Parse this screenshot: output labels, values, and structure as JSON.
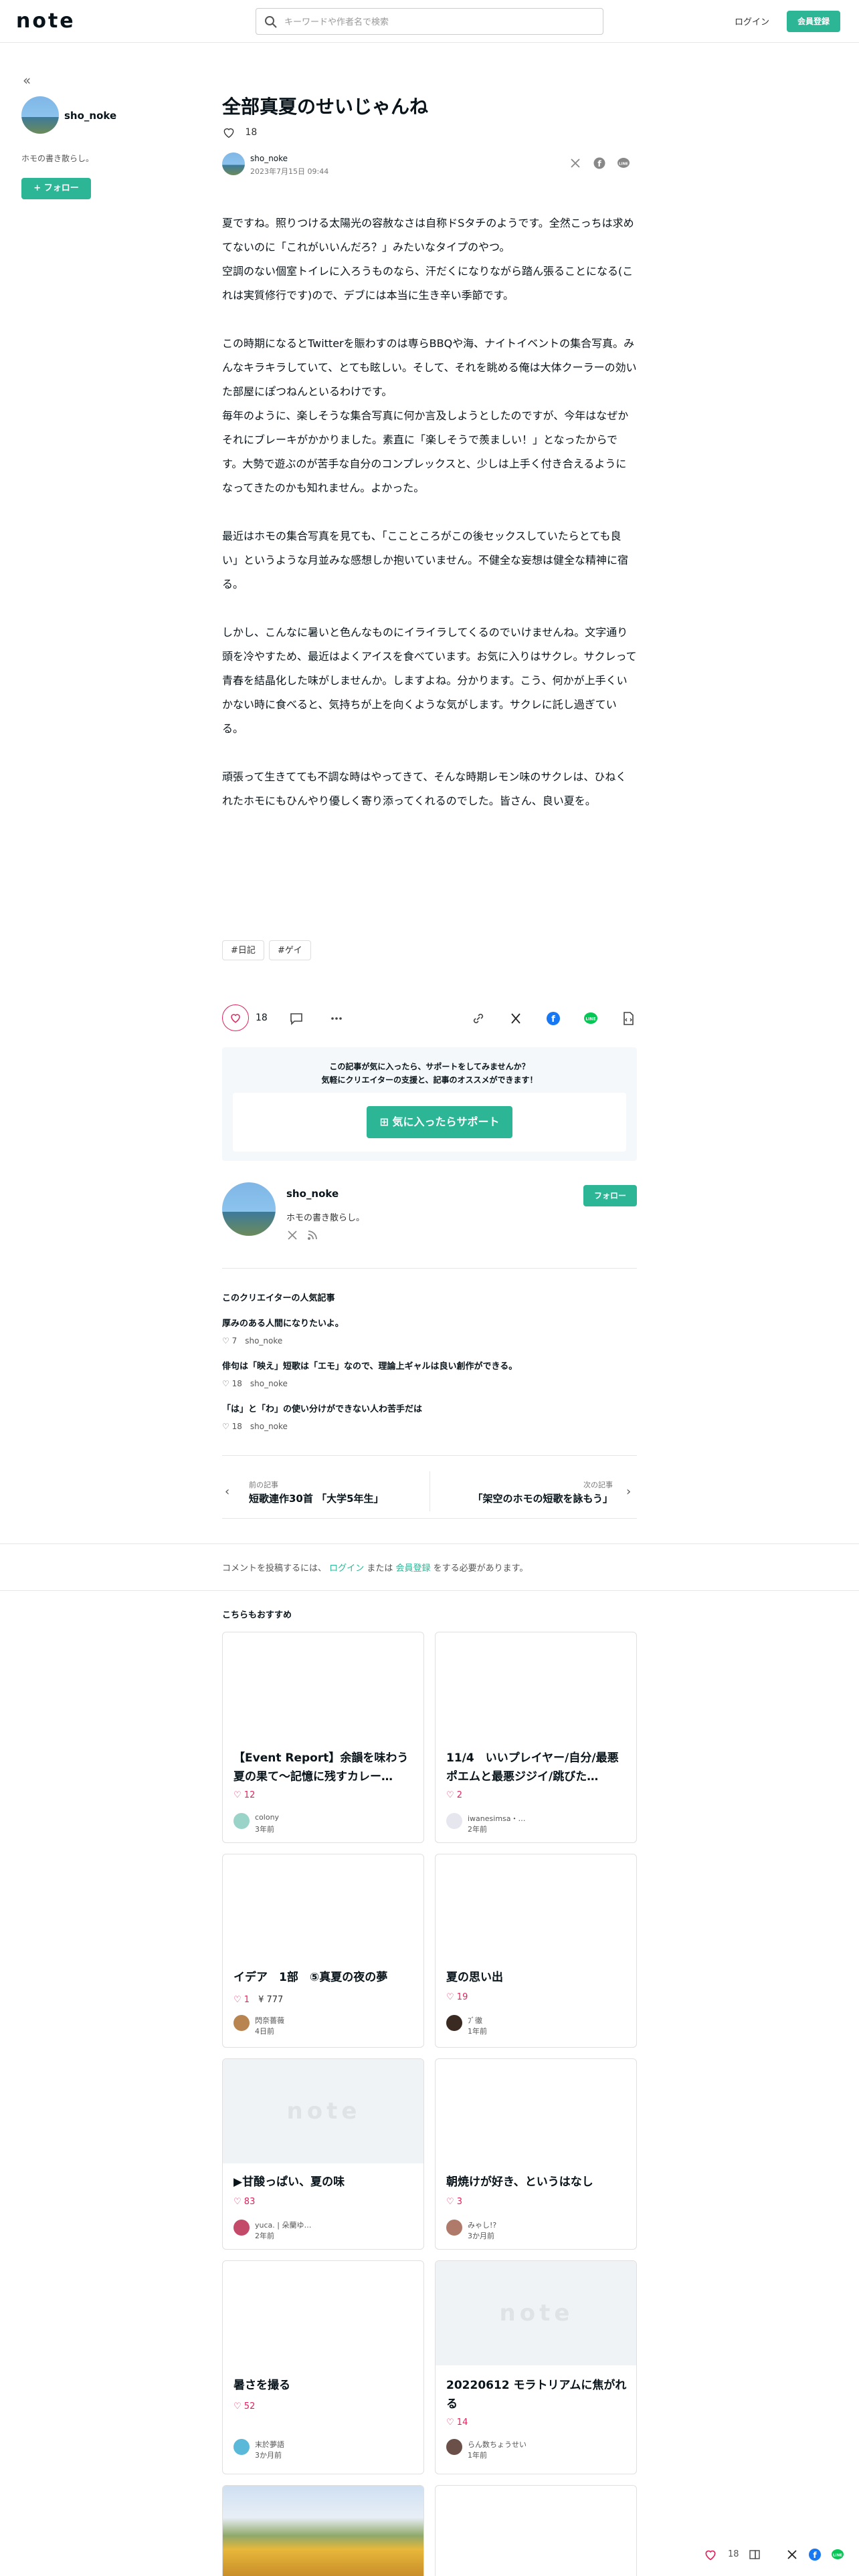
{
  "header": {
    "logo": "note",
    "search_placeholder": "キーワードや作者名で検索",
    "login": "ログイン",
    "signup": "会員登録"
  },
  "sidebar": {
    "name": "sho_noke",
    "bio": "ホモの書き散らし。",
    "follow": "フォロー"
  },
  "article": {
    "title": "全部真夏のせいじゃんね",
    "likes": "18",
    "author": "sho_noke",
    "date": "2023年7月15日 09:44",
    "paragraphs": [
      "夏ですね。照りつける太陽光の容赦なさは自称ドSタチのようです。全然こっちは求めてないのに「これがいいんだろ？」みたいなタイプのやつ。\n空調のない個室トイレに入ろうものなら、汗だくになりながら踏ん張ることになる(これは実質修行です)ので、デブには本当に生き辛い季節です。",
      "この時期になるとTwitterを賑わすのは専らBBQや海、ナイトイベントの集合写真。みんなキラキラしていて、とても眩しい。そして、それを眺める俺は大体クーラーの効いた部屋にぽつねんといるわけです。\n毎年のように、楽しそうな集合写真に何か言及しようとしたのですが、今年はなぜかそれにブレーキがかかりました。素直に「楽しそうで羨ましい！」となったからです。大勢で遊ぶのが苦手な自分のコンプレックスと、少しは上手く付き合えるようになってきたのかも知れません。よかった。",
      "最近はホモの集合写真を見ても、「ここところがこの後セックスしていたらとても良い」というような月並みな感想しか抱いていません。不健全な妄想は健全な精神に宿る。",
      "しかし、こんなに暑いと色んなものにイライラしてくるのでいけませんね。文字通り頭を冷やすため、最近はよくアイスを食べています。お気に入りはサクレ。サクレって青春を結晶化した味がしませんか。しますよね。分かります。こう、何かが上手くいかない時に食べると、気持ちが上を向くような気がします。サクレに託し過ぎている。",
      "頑張って生きてても不調な時はやってきて、そんな時期レモン味のサクレは、ひねくれたホモにもひんやり優しく寄り添ってくれるのでした。皆さん、良い夏を。"
    ],
    "tags": [
      "#日記",
      "#ゲイ"
    ],
    "like_count": "18"
  },
  "support": {
    "line1": "この記事が気に入ったら、サポートをしてみませんか？",
    "line2": "気軽にクリエイターの支援と、記事のオススメができます！",
    "button": "気に入ったらサポート"
  },
  "author_card": {
    "name": "sho_noke",
    "bio": "ホモの書き散らし。",
    "follow": "フォロー"
  },
  "popular": {
    "heading": "このクリエイターの人気記事",
    "items": [
      {
        "title": "厚みのある人間になりたいよ。",
        "likes": "7",
        "author": "sho_noke"
      },
      {
        "title": "俳句は「映え」短歌は「エモ」なので、理論上ギャルは良い創作ができる。",
        "likes": "18",
        "author": "sho_noke"
      },
      {
        "title": "「は」と「わ」の使い分けができない人わ苦手だは",
        "likes": "18",
        "author": "sho_noke"
      }
    ]
  },
  "nav": {
    "prev_label": "前の記事",
    "prev_title": "短歌連作30首 「大学5年生」",
    "next_label": "次の記事",
    "next_title": "「架空のホモの短歌を詠もう」"
  },
  "comment": {
    "pre": "コメントを投稿するには、",
    "login": "ログイン",
    "mid": "または",
    "signup": "会員登録",
    "post": "をする必要があります。"
  },
  "recommend": {
    "heading": "こちらもおすすめ",
    "cards": [
      {
        "title": "【Event Report】余韻を味わう夏の果て〜記憶に残すカレー…",
        "likes": "12",
        "author": "colony",
        "time": "3年前"
      },
      {
        "title": "11/4　いいプレイヤー/自分/最悪ポエムと最悪ジジイ/跳びた…",
        "likes": "2",
        "author": "iwanesimsa・…",
        "time": "2年前"
      },
      {
        "title": "イデア　1部　⑤真夏の夜の夢",
        "likes": "1",
        "price": "¥ 777",
        "author": "閃奈薔薇",
        "time": "4日前"
      },
      {
        "title": "夏の思い出",
        "likes": "19",
        "author": "ﾌﾞ徹",
        "time": "1年前"
      },
      {
        "title": "▶甘酸っぱい、夏の味",
        "likes": "83",
        "author": "yuca. | 朵蘭ゆ…",
        "time": "2年前"
      },
      {
        "title": "朝焼けが好き、というはなし",
        "likes": "3",
        "author": "みゃし!?",
        "time": "3か月前"
      },
      {
        "title": "暑さを撮る",
        "likes": "52",
        "author": "末於夢語",
        "time": "3か月前"
      },
      {
        "title": "20220612 モラトリアムに焦がれる",
        "likes": "14",
        "author": "らん数ちょうせい",
        "time": "1年前"
      }
    ]
  },
  "floating": {
    "likes": "18"
  }
}
